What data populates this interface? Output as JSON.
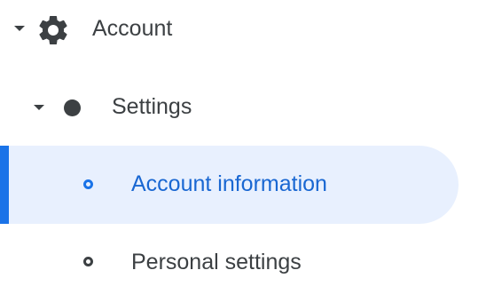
{
  "tree": {
    "account": {
      "label": "Account",
      "icon": "gear-icon",
      "expanded": true
    },
    "settings": {
      "label": "Settings",
      "icon": "filled-dot-icon",
      "expanded": true
    },
    "items": [
      {
        "label": "Account information",
        "icon": "ring-icon",
        "selected": true
      },
      {
        "label": "Personal settings",
        "icon": "ring-icon",
        "selected": false
      }
    ]
  },
  "colors": {
    "accent": "#1a73e8",
    "selected_text": "#1967d2",
    "selected_background": "#e8f0fe",
    "text": "#3c4043"
  }
}
